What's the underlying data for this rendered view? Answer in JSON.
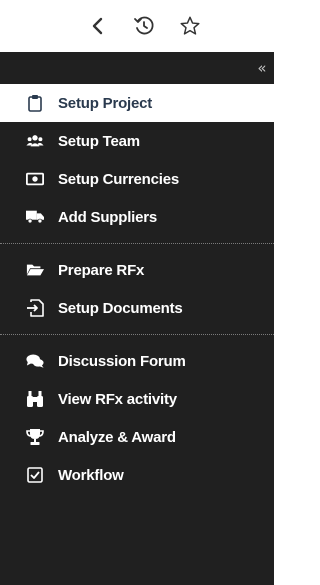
{
  "toolbar": {
    "back_icon": "chevron-left-icon",
    "history_icon": "history-icon",
    "favorite_icon": "star-icon"
  },
  "sidebar": {
    "collapse_glyph": "«",
    "groups": [
      [
        {
          "label": "Setup Project",
          "icon": "clipboard-icon",
          "active": true
        },
        {
          "label": "Setup Team",
          "icon": "users-icon"
        },
        {
          "label": "Setup Currencies",
          "icon": "money-bill-icon"
        },
        {
          "label": "Add Suppliers",
          "icon": "truck-icon"
        }
      ],
      [
        {
          "label": "Prepare RFx",
          "icon": "folder-open-icon"
        },
        {
          "label": "Setup Documents",
          "icon": "document-import-icon"
        }
      ],
      [
        {
          "label": "Discussion Forum",
          "icon": "comments-icon"
        },
        {
          "label": "View RFx activity",
          "icon": "binoculars-icon"
        },
        {
          "label": "Analyze & Award",
          "icon": "trophy-icon"
        },
        {
          "label": "Workflow",
          "icon": "check-square-icon"
        }
      ]
    ]
  },
  "colors": {
    "sidebar_bg": "#202020",
    "active_bg": "#ffffff",
    "active_text": "#2a3a4e",
    "item_text": "#ffffff"
  }
}
